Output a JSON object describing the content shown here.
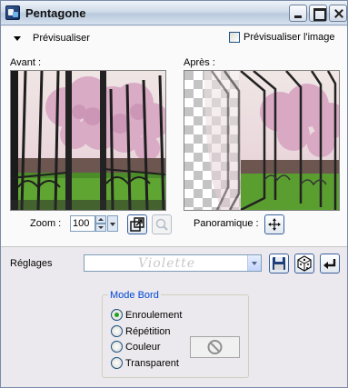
{
  "window": {
    "title": "Pentagone"
  },
  "preview_bar": {
    "label": "Prévisualiser",
    "checkbox_label": "Prévisualiser l'image",
    "checkbox_checked": false
  },
  "previews": {
    "before_label": "Avant :",
    "after_label": "Après :"
  },
  "zoom": {
    "label": "Zoom :",
    "value": "100"
  },
  "pan": {
    "label": "Panoramique :"
  },
  "settings": {
    "label": "Réglages",
    "watermark": "Violette"
  },
  "edge_mode": {
    "legend": "Mode Bord",
    "options": [
      {
        "label": "Enroulement",
        "selected": true
      },
      {
        "label": "Répétition",
        "selected": false
      },
      {
        "label": "Couleur",
        "selected": false
      },
      {
        "label": "Transparent",
        "selected": false
      }
    ]
  },
  "icons": {
    "app": "app-icon",
    "minimize": "minimize-icon",
    "maximize": "maximize-icon",
    "close": "close-icon",
    "fit": "fit-window-icon",
    "zoom_actual": "magnifier-icon",
    "pan": "move-cross-icon",
    "save": "floppy-disk-icon",
    "random": "dice-icon",
    "reset": "undo-arrow-icon",
    "no_color": "no-sign-icon"
  },
  "colors": {
    "accent": "#0046d5",
    "radio_selected": "#21a121",
    "blossom": "#d9a9c4"
  }
}
